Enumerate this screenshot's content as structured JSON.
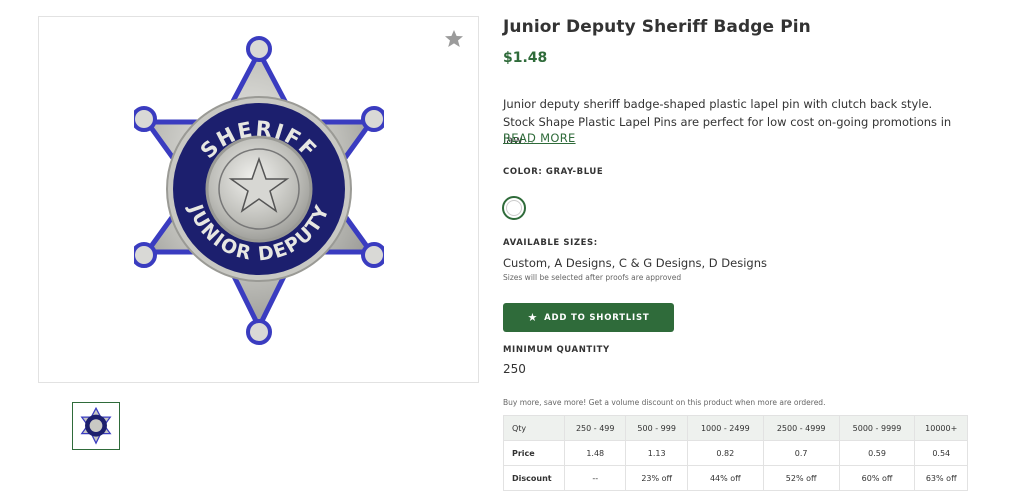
{
  "product": {
    "title": "Junior Deputy Sheriff Badge Pin",
    "price": "$1.48",
    "description": "Junior deputy sheriff badge-shaped plastic lapel pin with clutch back style. Stock Shape Plastic Lapel Pins are perfect for low cost on-going promotions in law…",
    "read_more": "READ MORE",
    "badge_text_top": "SHERIFF",
    "badge_text_bottom": "JUNIOR DEPUTY"
  },
  "color": {
    "label": "COLOR: GRAY-BLUE",
    "swatch_color": "#ffffff"
  },
  "sizes": {
    "label": "AVAILABLE SIZES:",
    "value": "Custom, A Designs, C & G Designs, D Designs",
    "note": "Sizes will be selected after proofs are approved"
  },
  "shortlist": {
    "icon": "star-icon",
    "label": "ADD TO SHORTLIST"
  },
  "min_quantity": {
    "label": "MINIMUM QUANTITY",
    "value": "250"
  },
  "bulk_note": "Buy more, save more! Get a volume discount on this product when more are ordered.",
  "pricing_table": {
    "headers": [
      "Qty",
      "250 - 499",
      "500 - 999",
      "1000 - 2499",
      "2500 - 4999",
      "5000 - 9999",
      "10000+"
    ],
    "price_row": [
      "Price",
      "1.48",
      "1.13",
      "0.82",
      "0.7",
      "0.59",
      "0.54"
    ],
    "discount_row": [
      "Discount",
      "--",
      "23% off",
      "44% off",
      "52% off",
      "60% off",
      "63% off"
    ]
  },
  "colors": {
    "accent": "#2f6b3a",
    "badge_blue": "#1c1f6e",
    "badge_silver": "#c9c9c4"
  }
}
